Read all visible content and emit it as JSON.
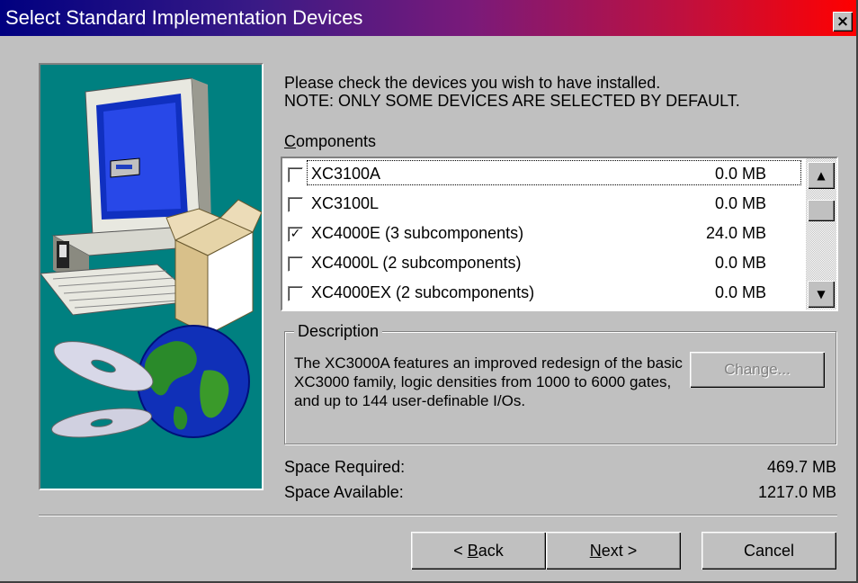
{
  "window": {
    "title": "Select Standard Implementation Devices",
    "close_glyph": "×"
  },
  "intro": {
    "line1": "Please check the devices you wish to have installed.",
    "line2": "NOTE: ONLY SOME DEVICES ARE SELECTED BY DEFAULT."
  },
  "components": {
    "label_mnemonic": "C",
    "label_rest": "omponents",
    "items": [
      {
        "name": "XC3100A",
        "size": "0.0 MB",
        "checked": false,
        "focused": true
      },
      {
        "name": "XC3100L",
        "size": "0.0 MB",
        "checked": false,
        "focused": false
      },
      {
        "name": "XC4000E (3 subcomponents)",
        "size": "24.0 MB",
        "checked": true,
        "focused": false
      },
      {
        "name": "XC4000L (2 subcomponents)",
        "size": "0.0 MB",
        "checked": false,
        "focused": false
      },
      {
        "name": "XC4000EX (2 subcomponents)",
        "size": "0.0 MB",
        "checked": false,
        "focused": false
      }
    ],
    "scroll_up_glyph": "▲",
    "scroll_down_glyph": "▼",
    "check_glyph": "✓"
  },
  "description": {
    "legend": "Description",
    "text": "The XC3000A features an improved redesign of the basic XC3000 family, logic densities from 1000 to 6000 gates, and up to 144 user-definable I/Os.",
    "change_label": "Change..."
  },
  "space": {
    "required_label": "Space Required:",
    "required_value": "469.7 MB",
    "available_label": "Space Available:",
    "available_value": "1217.0 MB"
  },
  "buttons": {
    "back_prefix": "< ",
    "back_mnemonic": "B",
    "back_rest": "ack",
    "next_mnemonic": "N",
    "next_rest": "ext >",
    "cancel": "Cancel"
  },
  "colors": {
    "dialog": "#c0c0c0",
    "image_bg": "#008080",
    "title_start": "#000080",
    "title_end": "#ff0000"
  }
}
